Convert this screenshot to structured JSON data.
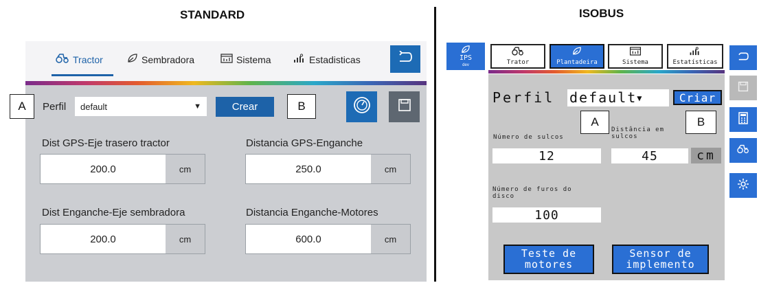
{
  "titles": {
    "standard": "STANDARD",
    "isobus": "ISOBUS"
  },
  "callouts": {
    "a": "A",
    "b": "B"
  },
  "standard": {
    "tabs": [
      {
        "label": "Tractor",
        "icon": "tractor-icon",
        "active": true
      },
      {
        "label": "Sembradora",
        "icon": "leaf-icon",
        "active": false
      },
      {
        "label": "Sistema",
        "icon": "system-icon",
        "active": false
      },
      {
        "label": "Estadisticas",
        "icon": "statistics-icon",
        "active": false
      }
    ],
    "perfil_label": "Perfil",
    "perfil_value": "default",
    "crear_label": "Crear",
    "fields": [
      {
        "label": "Dist GPS-Eje trasero tractor",
        "value": "200.0",
        "unit": "cm"
      },
      {
        "label": "Distancia GPS-Enganche",
        "value": "250.0",
        "unit": "cm"
      },
      {
        "label": "Dist Enganche-Eje sembradora",
        "value": "200.0",
        "unit": "cm"
      },
      {
        "label": "Distancia Enganche-Motores",
        "value": "600.0",
        "unit": "cm"
      }
    ],
    "colors": {
      "accent": "#1d62a8",
      "panel": "#ccced2",
      "save_button": "#5e6771"
    }
  },
  "isobus": {
    "left_button": {
      "label": "IPS",
      "sub": "dev"
    },
    "tabs": [
      {
        "label": "Trator",
        "active": false
      },
      {
        "label": "Plantadeira",
        "active": true
      },
      {
        "label": "Sistema",
        "active": false
      },
      {
        "label": "Estatísticas",
        "active": false
      }
    ],
    "perfil_label": "Perfil",
    "perfil_value": "default",
    "criar_label": "Criar",
    "numero_sulcos_label": "Número de sulcos",
    "numero_sulcos_value": "12",
    "distancia_label_1": "Distância em",
    "distancia_label_2": "sulcos",
    "distancia_value": "45",
    "distancia_unit": "cm",
    "furos_label_1": "Número de furos do",
    "furos_label_2": "disco",
    "furos_value": "100",
    "teste_label_1": "Teste de",
    "teste_label_2": "motores",
    "sensor_label_1": "Sensor de",
    "sensor_label_2": "implemento",
    "side_buttons": [
      "back-icon",
      "save-icon",
      "calculator-icon",
      "tractor-icon",
      "gear-icon"
    ],
    "colors": {
      "accent": "#2a6fd4",
      "panel": "#c8c8c8"
    }
  }
}
